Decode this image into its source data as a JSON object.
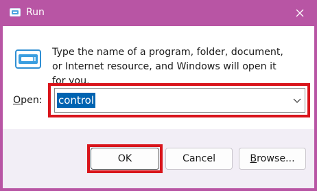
{
  "window": {
    "title": "Run",
    "description": "Type the name of a program, folder, document, or Internet resource, and Windows will open it for you."
  },
  "open": {
    "label_underlined": "O",
    "label_rest": "pen:",
    "value": "control"
  },
  "buttons": {
    "ok": "OK",
    "cancel": "Cancel",
    "browse_underlined": "B",
    "browse_rest": "rowse..."
  },
  "colors": {
    "titlebar": "#b855a4",
    "selection": "#0063b1",
    "highlight": "#d9141b",
    "footer": "#f2eef6"
  },
  "icons": {
    "app": "run-app-icon",
    "close": "close-icon",
    "dropdown": "chevron-down-icon"
  }
}
